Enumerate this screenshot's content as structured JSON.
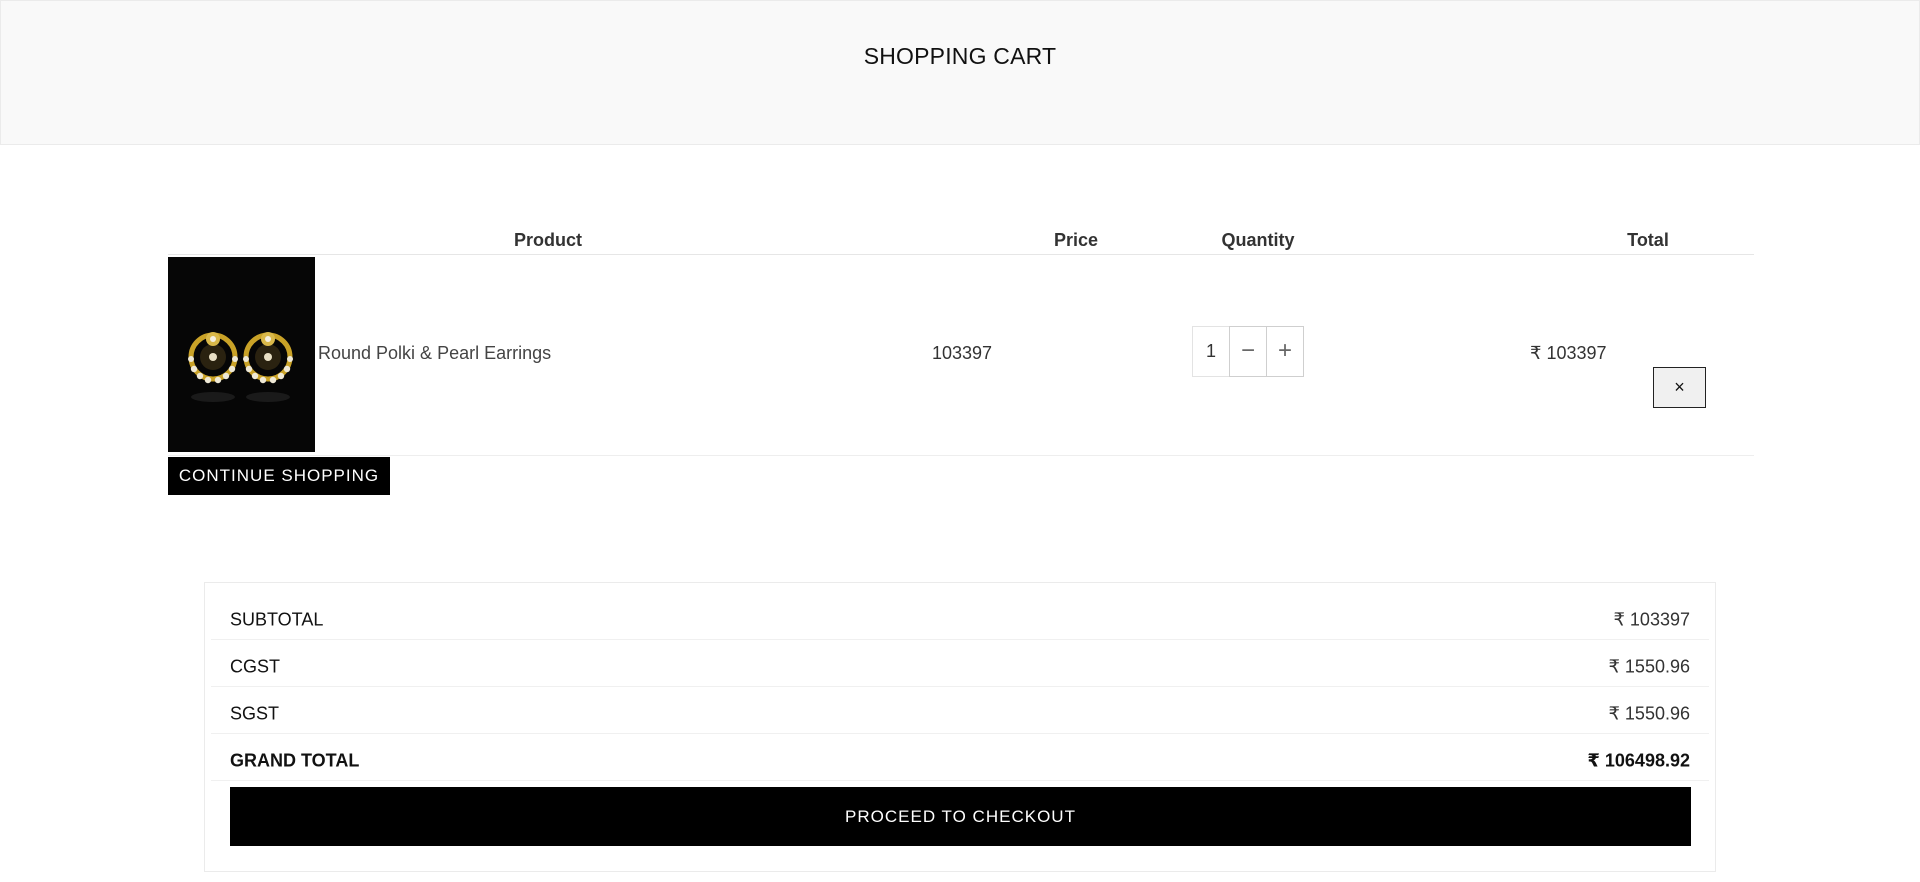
{
  "header": {
    "title": "SHOPPING CART"
  },
  "table": {
    "columns": [
      "Product",
      "Price",
      "Quantity",
      "Total"
    ],
    "items": [
      {
        "image_alt": "gold polki earrings",
        "name": "Round Polki & Pearl Earrings",
        "price": "103397",
        "quantity": "1",
        "total": "₹ 103397",
        "remove_label": "×",
        "decrease_label": "−",
        "increase_label": "+"
      }
    ]
  },
  "continue_label": "CONTINUE SHOPPING",
  "summary": {
    "rows": [
      {
        "label": "SUBTOTAL",
        "value": "₹ 103397"
      },
      {
        "label": "CGST",
        "value": "₹ 1550.96"
      },
      {
        "label": "SGST",
        "value": "₹ 1550.96"
      },
      {
        "label": "GRAND TOTAL",
        "value": "₹ 106498.92"
      }
    ],
    "checkout_label": "PROCEED TO CHECKOUT"
  },
  "colors": {
    "header_bg": "#f9f9f9",
    "button_bg": "#000000",
    "button_text": "#ffffff",
    "earring_gold": "#c9a227"
  },
  "icons": {
    "remove": "close-icon",
    "decrease": "minus-icon",
    "increase": "plus-icon"
  }
}
